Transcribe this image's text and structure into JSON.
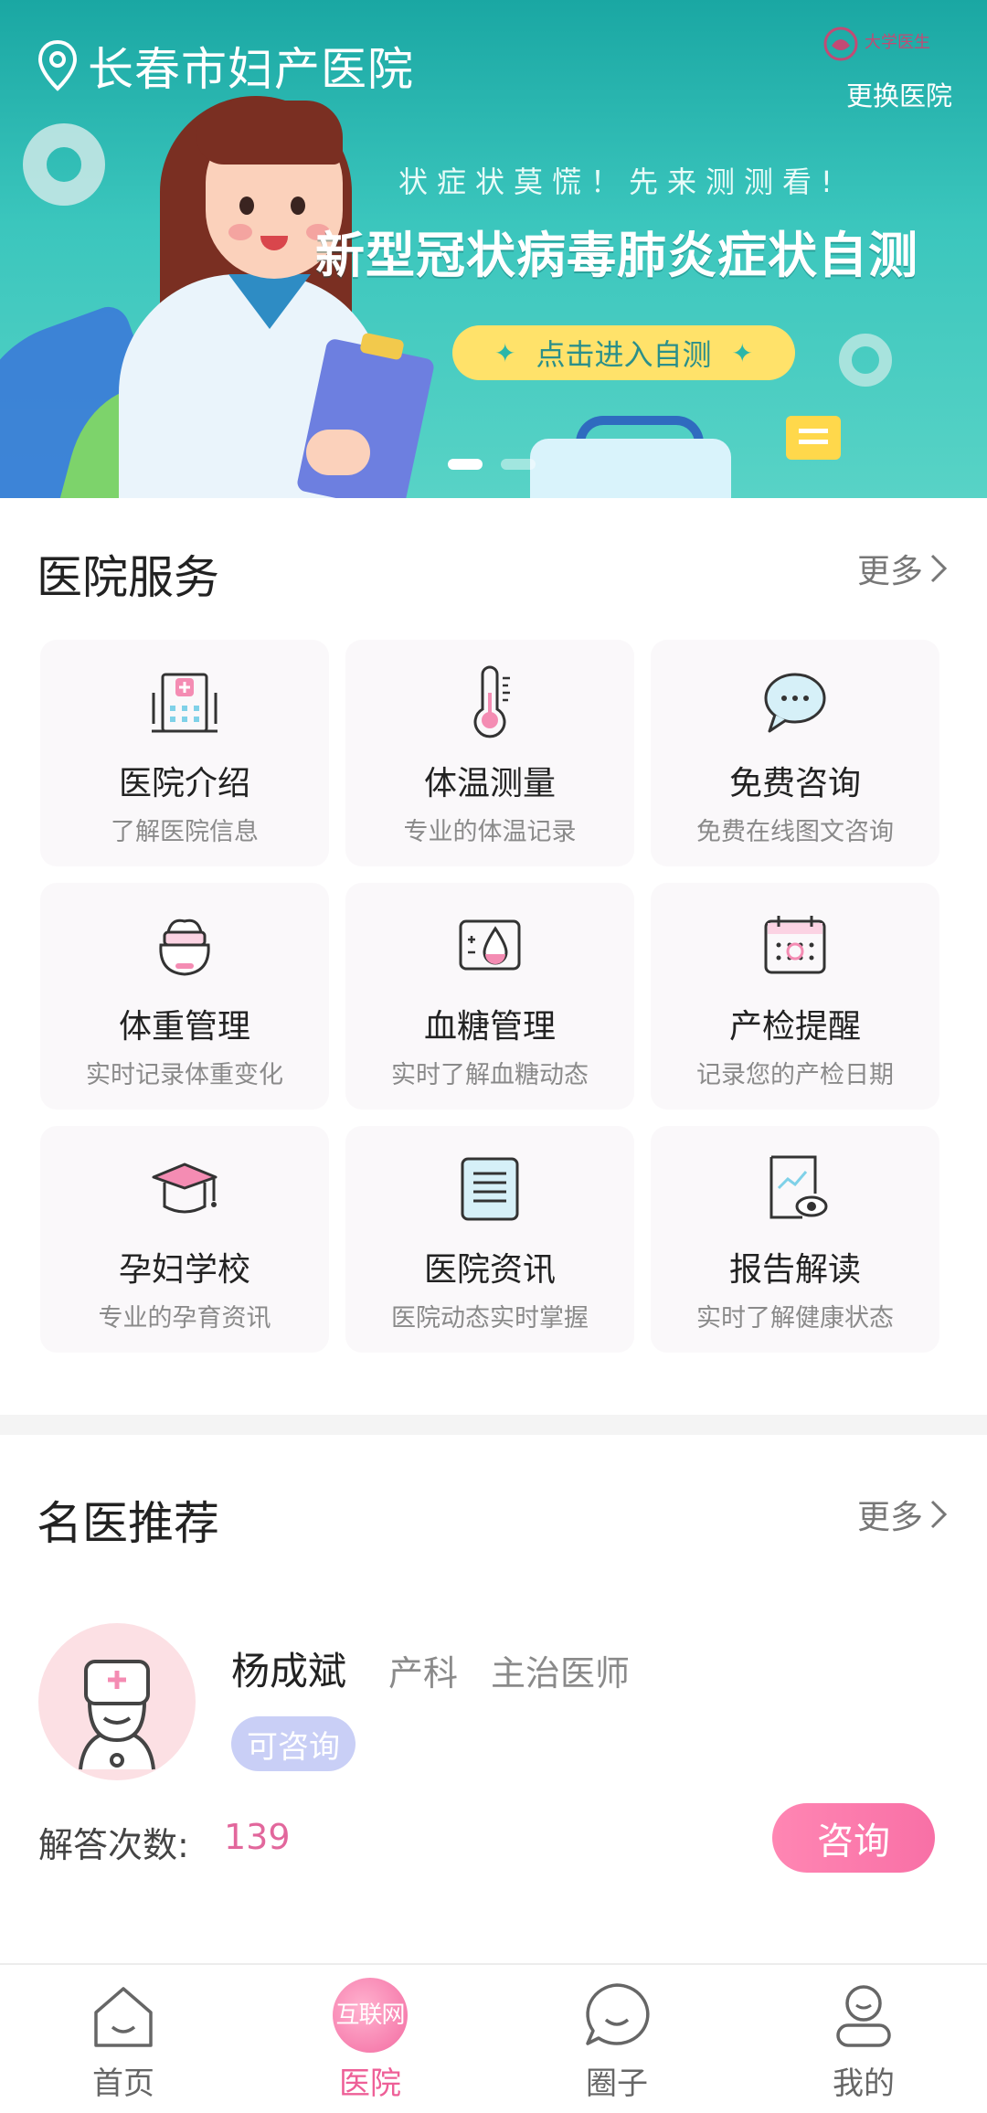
{
  "banner": {
    "location": "长春市妇产医院",
    "logo_text": "大学医生",
    "change_hospital": "更换医院",
    "tagline": "状症状莫慌！先来测测看!",
    "headline": "新型冠状病毒肺炎症状自测",
    "cta": "点击进入自测",
    "cta_star": "✦",
    "slide_count": 2,
    "active_slide": 1
  },
  "hospital_services": {
    "title": "医院服务",
    "more": "更多",
    "items": [
      {
        "title": "医院介绍",
        "subtitle": "了解医院信息",
        "icon": "hospital-icon"
      },
      {
        "title": "体温测量",
        "subtitle": "专业的体温记录",
        "icon": "thermometer-icon"
      },
      {
        "title": "免费咨询",
        "subtitle": "免费在线图文咨询",
        "icon": "chat-bubble-icon"
      },
      {
        "title": "体重管理",
        "subtitle": "实时记录体重变化",
        "icon": "weight-scale-icon"
      },
      {
        "title": "血糖管理",
        "subtitle": "实时了解血糖动态",
        "icon": "blood-drop-icon"
      },
      {
        "title": "产检提醒",
        "subtitle": "记录您的产检日期",
        "icon": "calendar-icon"
      },
      {
        "title": "孕妇学校",
        "subtitle": "专业的孕育资讯",
        "icon": "graduation-cap-icon"
      },
      {
        "title": "医院资讯",
        "subtitle": "医院动态实时掌握",
        "icon": "news-icon"
      },
      {
        "title": "报告解读",
        "subtitle": "实时了解健康状态",
        "icon": "report-eye-icon"
      }
    ]
  },
  "doctor_recommend": {
    "title": "名医推荐",
    "more": "更多",
    "doctor": {
      "name": "杨成斌",
      "department": "产科",
      "position": "主治医师",
      "status_badge": "可咨询",
      "answer_label": "解答次数:",
      "answer_count": "139",
      "consult_button": "咨询"
    }
  },
  "bottom_nav": {
    "items": [
      {
        "label": "首页",
        "icon": "home-icon",
        "active": false
      },
      {
        "label": "医院",
        "icon": "hospital-globe-icon",
        "active": true,
        "icon_text": "互联网"
      },
      {
        "label": "圈子",
        "icon": "chat-circle-icon",
        "active": false
      },
      {
        "label": "我的",
        "icon": "profile-icon",
        "active": false
      }
    ]
  },
  "colors": {
    "accent": "#ee5f97",
    "banner": "#2bb6a9",
    "badge": "#c9cff6",
    "cta": "#ffe26a"
  }
}
